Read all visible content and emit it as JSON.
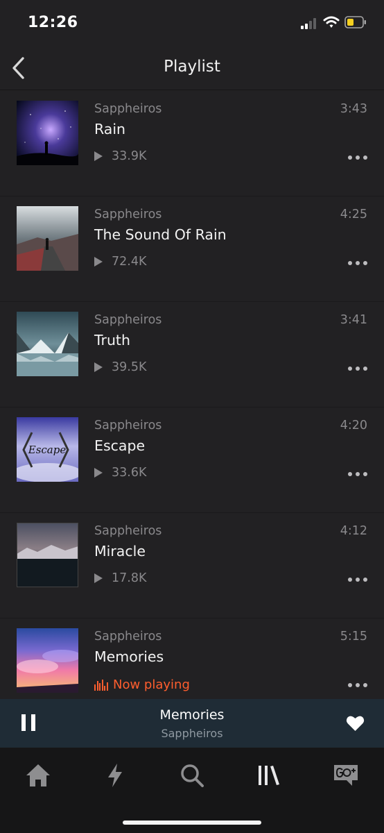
{
  "status_bar": {
    "time": "12:26",
    "icons": [
      "cellular-signal-icon",
      "wifi-icon",
      "battery-icon"
    ],
    "battery_color": "#f5d020"
  },
  "nav": {
    "title": "Playlist",
    "back_icon": "chevron-left-icon"
  },
  "tracks": [
    {
      "artist": "Sappheiros",
      "title": "Rain",
      "duration": "3:43",
      "plays": "33.9K"
    },
    {
      "artist": "Sappheiros",
      "title": "The Sound Of Rain",
      "duration": "4:25",
      "plays": "72.4K"
    },
    {
      "artist": "Sappheiros",
      "title": "Truth",
      "duration": "3:41",
      "plays": "39.5K"
    },
    {
      "artist": "Sappheiros",
      "title": "Escape",
      "duration": "4:20",
      "plays": "33.6K",
      "artwork_text": "Escape"
    },
    {
      "artist": "Sappheiros",
      "title": "Miracle",
      "duration": "4:12",
      "plays": "17.8K"
    },
    {
      "artist": "Sappheiros",
      "title": "Memories",
      "duration": "5:15",
      "status": "Now playing"
    }
  ],
  "mini_player": {
    "title": "Memories",
    "artist": "Sappheiros",
    "liked": true
  },
  "tab_bar": {
    "tabs": [
      "home-icon",
      "stream-bolt-icon",
      "search-icon",
      "library-icon",
      "go-plus-icon"
    ],
    "active_tab": "library-icon"
  },
  "colors": {
    "background": "#222123",
    "accent": "#ff5e2e",
    "mini_player": "#1f2c36",
    "secondary_text": "#8a898c"
  }
}
